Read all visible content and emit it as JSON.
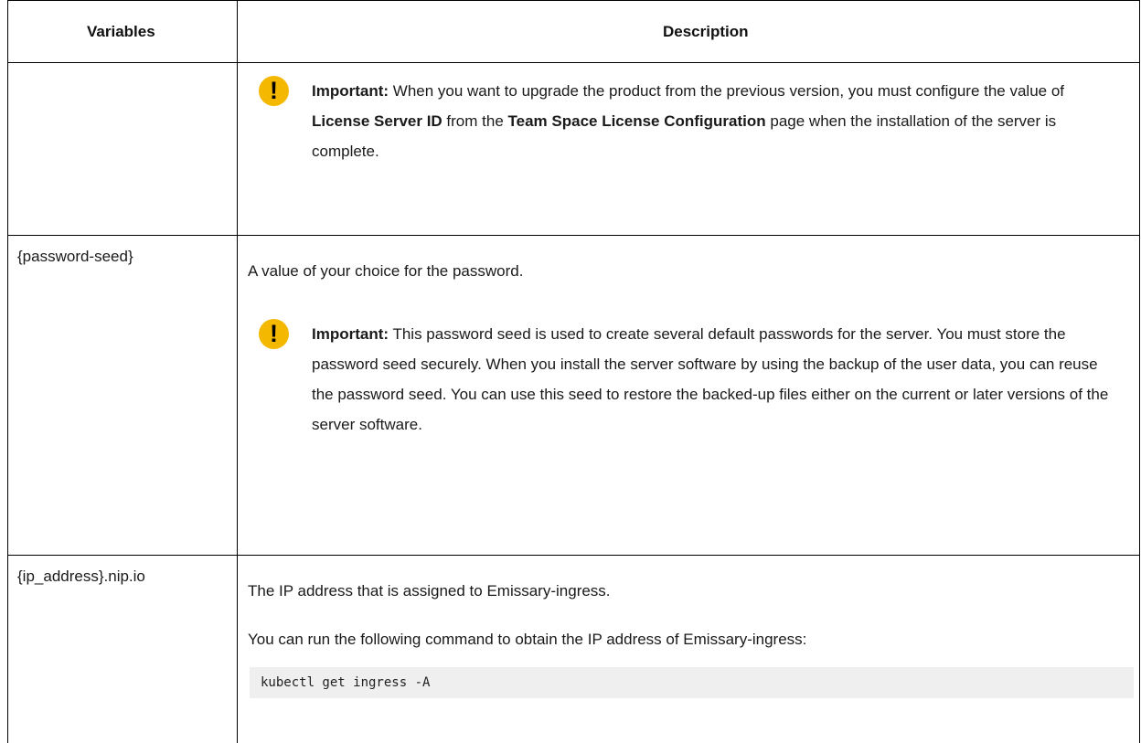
{
  "table": {
    "headers": {
      "variables": "Variables",
      "description": "Description"
    },
    "row1": {
      "variable": "",
      "note": {
        "icon": "important-icon",
        "label": "Important:",
        "t1": " When you want to upgrade the product from the previous version, you must configure the value of ",
        "b1": "License Server ID",
        "t2": " from the ",
        "b2": "Team Space License Configuration",
        "t3": " page when the installation of the server is complete."
      }
    },
    "row2": {
      "variable": "{password-seed}",
      "description": "A value of your choice for the password.",
      "note": {
        "icon": "important-icon",
        "label": "Important:",
        "text": " This password seed is used to create several default passwords for the server. You must store the password seed securely. When you install the server software by using the backup of the user data, you can reuse the password seed. You can use this seed to restore the backed-up files either on the current or later versions of the server software."
      }
    },
    "row3": {
      "variable": "{ip_address}.nip.io",
      "description": "The IP address that is assigned to Emissary-ingress.",
      "description2": "You can run the following command to obtain the IP address of Emissary-ingress:",
      "code": "kubectl get ingress -A"
    }
  },
  "colors": {
    "important_icon": "#f5b800",
    "code_bg": "#efefef"
  }
}
